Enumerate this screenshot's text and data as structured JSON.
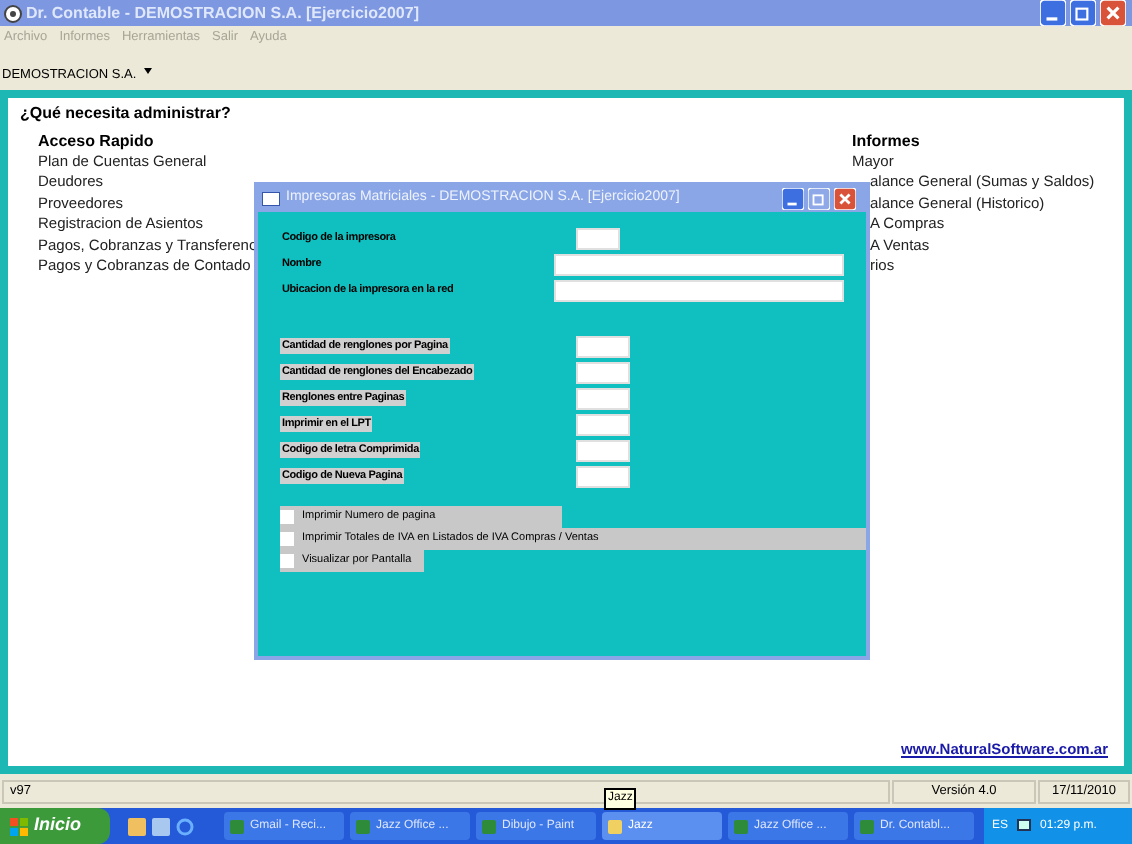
{
  "window": {
    "title": "Dr. Contable - DEMOSTRACION S.A.  [Ejercicio2007]"
  },
  "menu": [
    "Archivo",
    "Informes",
    "Herramientas",
    "Salir",
    "Ayuda"
  ],
  "company_selector": {
    "value": "DEMOSTRACION S.A."
  },
  "heading": "¿Qué necesita administrar?",
  "quick_access": {
    "title": "Acceso Rapido",
    "items": [
      "Plan de Cuentas General",
      "Deudores",
      "Proveedores",
      "Registracion de Asientos",
      "Pagos, Cobranzas y Transferenc",
      "Pagos y Cobranzas de Contado"
    ]
  },
  "reports": {
    "title": "Informes",
    "items": [
      "Mayor"
    ],
    "partly_covered_items": [
      "alance General (Sumas y Saldos)",
      "alance General (Historico)",
      "A Compras",
      "A Ventas",
      "rios"
    ]
  },
  "website_link": "www.NaturalSoftware.com.ar",
  "dialog": {
    "title": "Impresoras Matriciales - DEMOSTRACION S.A.  [Ejercicio2007]",
    "field_groups": [
      [
        {
          "label": "Codigo de la impresora",
          "kind": "short",
          "highlight": false
        },
        {
          "label": "Nombre",
          "kind": "long",
          "highlight": false
        },
        {
          "label": "Ubicacion de la impresora en la red",
          "kind": "long",
          "highlight": false
        }
      ],
      [
        {
          "label": "Cantidad de renglones por Pagina",
          "kind": "medium",
          "highlight": true
        },
        {
          "label": "Cantidad de renglones del Encabezado",
          "kind": "medium",
          "highlight": true
        },
        {
          "label": "Renglones entre Paginas",
          "kind": "medium",
          "highlight": true
        },
        {
          "label": "Imprimir en el LPT",
          "kind": "medium",
          "highlight": true
        },
        {
          "label": "Codigo de letra Comprimida",
          "kind": "medium",
          "highlight": true
        },
        {
          "label": "Codigo de Nueva Pagina",
          "kind": "medium",
          "highlight": true
        }
      ]
    ],
    "options": [
      {
        "label": "Imprimir Numero de pagina",
        "checked": false,
        "kind": "narrow"
      },
      {
        "label": "Imprimir Totales de IVA en Listados de IVA Compras / Ventas",
        "checked": false,
        "kind": "wide"
      },
      {
        "label": "Visualizar por Pantalla",
        "checked": false,
        "kind": "small"
      }
    ]
  },
  "status_bar": [
    "v97",
    "Versión 4.0",
    "17/11/2010"
  ],
  "taskbar": {
    "start": "Inicio",
    "tooltip": "Jazz",
    "buttons": [
      {
        "label": "Gmail - Reci...",
        "selected": false
      },
      {
        "label": "Jazz Office ...",
        "selected": false
      },
      {
        "label": "Dibujo - Paint",
        "selected": false
      },
      {
        "label": "Jazz",
        "selected": true
      },
      {
        "label": "Jazz Office ...",
        "selected": false
      },
      {
        "label": "Dr. Contabl...",
        "selected": false
      }
    ],
    "language": "ES",
    "clock": "01:29 p.m."
  }
}
